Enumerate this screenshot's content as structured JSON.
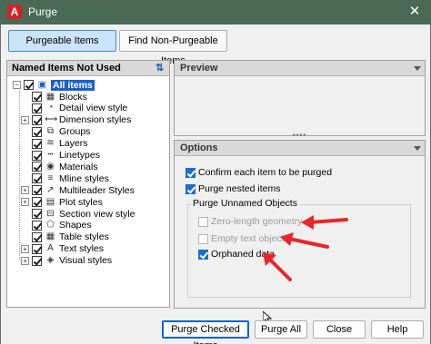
{
  "window": {
    "title": "Purge",
    "app_icon_letter": "A",
    "close_glyph": "✕"
  },
  "tabs": [
    {
      "label": "Purgeable Items",
      "active": true
    },
    {
      "label": "Find Non-Purgeable Items",
      "active": false
    }
  ],
  "named_items": {
    "header": "Named Items Not Used",
    "root": {
      "label": "All items",
      "checked": true
    },
    "items": [
      {
        "label": "Blocks",
        "checked": true,
        "expandable": false,
        "icon": "blocks-icon",
        "glyph": "▦"
      },
      {
        "label": "Detail view style",
        "checked": true,
        "expandable": false,
        "icon": "detail-view-icon",
        "glyph": "◔"
      },
      {
        "label": "Dimension styles",
        "checked": true,
        "expandable": true,
        "icon": "dimension-icon",
        "glyph": "⟷"
      },
      {
        "label": "Groups",
        "checked": true,
        "expandable": false,
        "icon": "groups-icon",
        "glyph": "⧉"
      },
      {
        "label": "Layers",
        "checked": true,
        "expandable": false,
        "icon": "layers-icon",
        "glyph": "≋"
      },
      {
        "label": "Linetypes",
        "checked": true,
        "expandable": false,
        "icon": "linetypes-icon",
        "glyph": "┅"
      },
      {
        "label": "Materials",
        "checked": true,
        "expandable": false,
        "icon": "materials-icon",
        "glyph": "◉"
      },
      {
        "label": "Mline styles",
        "checked": true,
        "expandable": false,
        "icon": "mline-icon",
        "glyph": "≡"
      },
      {
        "label": "Multileader Styles",
        "checked": true,
        "expandable": true,
        "icon": "multileader-icon",
        "glyph": "↗"
      },
      {
        "label": "Plot styles",
        "checked": true,
        "expandable": true,
        "icon": "plot-styles-icon",
        "glyph": "▤"
      },
      {
        "label": "Section view style",
        "checked": true,
        "expandable": false,
        "icon": "section-view-icon",
        "glyph": "⊟"
      },
      {
        "label": "Shapes",
        "checked": true,
        "expandable": false,
        "icon": "shapes-icon",
        "glyph": "⬠"
      },
      {
        "label": "Table styles",
        "checked": true,
        "expandable": false,
        "icon": "table-icon",
        "glyph": "▦"
      },
      {
        "label": "Text styles",
        "checked": true,
        "expandable": true,
        "icon": "text-styles-icon",
        "glyph": "A"
      },
      {
        "label": "Visual styles",
        "checked": true,
        "expandable": true,
        "icon": "visual-styles-icon",
        "glyph": "◈"
      }
    ]
  },
  "preview": {
    "header": "Preview"
  },
  "options": {
    "header": "Options",
    "confirm": {
      "label": "Confirm each item to be purged",
      "checked": true
    },
    "nested": {
      "label": "Purge nested items",
      "checked": true
    },
    "unnamed_group": "Purge Unnamed Objects",
    "zero_length": {
      "label": "Zero-length geometry",
      "checked": false,
      "enabled": false
    },
    "empty_text": {
      "label": "Empty text objects",
      "checked": false,
      "enabled": false
    },
    "orphaned": {
      "label": "Orphaned data",
      "checked": true,
      "enabled": true
    }
  },
  "buttons": {
    "purge_checked": "Purge Checked Items",
    "purge_all": "Purge All",
    "close": "Close",
    "help": "Help"
  },
  "colors": {
    "accent": "#1a6fc9",
    "titlebar": "#4a6a55",
    "annotation_arrow": "#e8262b"
  }
}
